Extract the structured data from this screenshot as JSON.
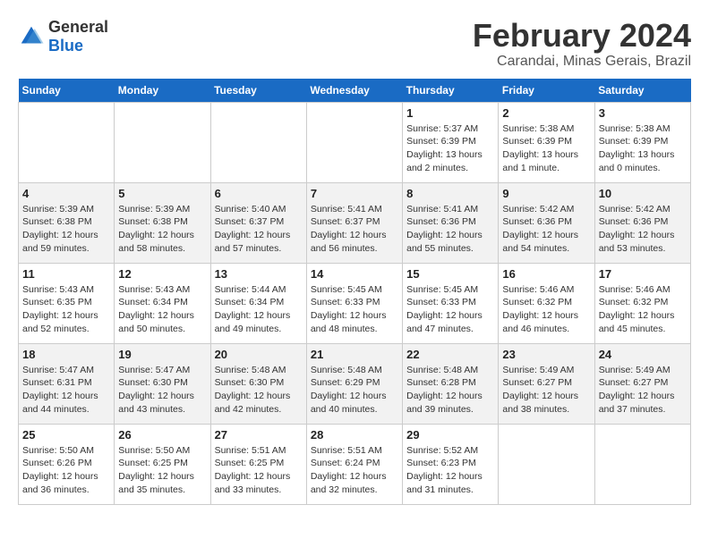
{
  "header": {
    "logo_general": "General",
    "logo_blue": "Blue",
    "title": "February 2024",
    "subtitle": "Carandai, Minas Gerais, Brazil"
  },
  "calendar": {
    "days_of_week": [
      "Sunday",
      "Monday",
      "Tuesday",
      "Wednesday",
      "Thursday",
      "Friday",
      "Saturday"
    ],
    "weeks": [
      [
        {
          "day": "",
          "info": ""
        },
        {
          "day": "",
          "info": ""
        },
        {
          "day": "",
          "info": ""
        },
        {
          "day": "",
          "info": ""
        },
        {
          "day": "1",
          "info": "Sunrise: 5:37 AM\nSunset: 6:39 PM\nDaylight: 13 hours\nand 2 minutes."
        },
        {
          "day": "2",
          "info": "Sunrise: 5:38 AM\nSunset: 6:39 PM\nDaylight: 13 hours\nand 1 minute."
        },
        {
          "day": "3",
          "info": "Sunrise: 5:38 AM\nSunset: 6:39 PM\nDaylight: 13 hours\nand 0 minutes."
        }
      ],
      [
        {
          "day": "4",
          "info": "Sunrise: 5:39 AM\nSunset: 6:38 PM\nDaylight: 12 hours\nand 59 minutes."
        },
        {
          "day": "5",
          "info": "Sunrise: 5:39 AM\nSunset: 6:38 PM\nDaylight: 12 hours\nand 58 minutes."
        },
        {
          "day": "6",
          "info": "Sunrise: 5:40 AM\nSunset: 6:37 PM\nDaylight: 12 hours\nand 57 minutes."
        },
        {
          "day": "7",
          "info": "Sunrise: 5:41 AM\nSunset: 6:37 PM\nDaylight: 12 hours\nand 56 minutes."
        },
        {
          "day": "8",
          "info": "Sunrise: 5:41 AM\nSunset: 6:36 PM\nDaylight: 12 hours\nand 55 minutes."
        },
        {
          "day": "9",
          "info": "Sunrise: 5:42 AM\nSunset: 6:36 PM\nDaylight: 12 hours\nand 54 minutes."
        },
        {
          "day": "10",
          "info": "Sunrise: 5:42 AM\nSunset: 6:36 PM\nDaylight: 12 hours\nand 53 minutes."
        }
      ],
      [
        {
          "day": "11",
          "info": "Sunrise: 5:43 AM\nSunset: 6:35 PM\nDaylight: 12 hours\nand 52 minutes."
        },
        {
          "day": "12",
          "info": "Sunrise: 5:43 AM\nSunset: 6:34 PM\nDaylight: 12 hours\nand 50 minutes."
        },
        {
          "day": "13",
          "info": "Sunrise: 5:44 AM\nSunset: 6:34 PM\nDaylight: 12 hours\nand 49 minutes."
        },
        {
          "day": "14",
          "info": "Sunrise: 5:45 AM\nSunset: 6:33 PM\nDaylight: 12 hours\nand 48 minutes."
        },
        {
          "day": "15",
          "info": "Sunrise: 5:45 AM\nSunset: 6:33 PM\nDaylight: 12 hours\nand 47 minutes."
        },
        {
          "day": "16",
          "info": "Sunrise: 5:46 AM\nSunset: 6:32 PM\nDaylight: 12 hours\nand 46 minutes."
        },
        {
          "day": "17",
          "info": "Sunrise: 5:46 AM\nSunset: 6:32 PM\nDaylight: 12 hours\nand 45 minutes."
        }
      ],
      [
        {
          "day": "18",
          "info": "Sunrise: 5:47 AM\nSunset: 6:31 PM\nDaylight: 12 hours\nand 44 minutes."
        },
        {
          "day": "19",
          "info": "Sunrise: 5:47 AM\nSunset: 6:30 PM\nDaylight: 12 hours\nand 43 minutes."
        },
        {
          "day": "20",
          "info": "Sunrise: 5:48 AM\nSunset: 6:30 PM\nDaylight: 12 hours\nand 42 minutes."
        },
        {
          "day": "21",
          "info": "Sunrise: 5:48 AM\nSunset: 6:29 PM\nDaylight: 12 hours\nand 40 minutes."
        },
        {
          "day": "22",
          "info": "Sunrise: 5:48 AM\nSunset: 6:28 PM\nDaylight: 12 hours\nand 39 minutes."
        },
        {
          "day": "23",
          "info": "Sunrise: 5:49 AM\nSunset: 6:27 PM\nDaylight: 12 hours\nand 38 minutes."
        },
        {
          "day": "24",
          "info": "Sunrise: 5:49 AM\nSunset: 6:27 PM\nDaylight: 12 hours\nand 37 minutes."
        }
      ],
      [
        {
          "day": "25",
          "info": "Sunrise: 5:50 AM\nSunset: 6:26 PM\nDaylight: 12 hours\nand 36 minutes."
        },
        {
          "day": "26",
          "info": "Sunrise: 5:50 AM\nSunset: 6:25 PM\nDaylight: 12 hours\nand 35 minutes."
        },
        {
          "day": "27",
          "info": "Sunrise: 5:51 AM\nSunset: 6:25 PM\nDaylight: 12 hours\nand 33 minutes."
        },
        {
          "day": "28",
          "info": "Sunrise: 5:51 AM\nSunset: 6:24 PM\nDaylight: 12 hours\nand 32 minutes."
        },
        {
          "day": "29",
          "info": "Sunrise: 5:52 AM\nSunset: 6:23 PM\nDaylight: 12 hours\nand 31 minutes."
        },
        {
          "day": "",
          "info": ""
        },
        {
          "day": "",
          "info": ""
        }
      ]
    ]
  }
}
